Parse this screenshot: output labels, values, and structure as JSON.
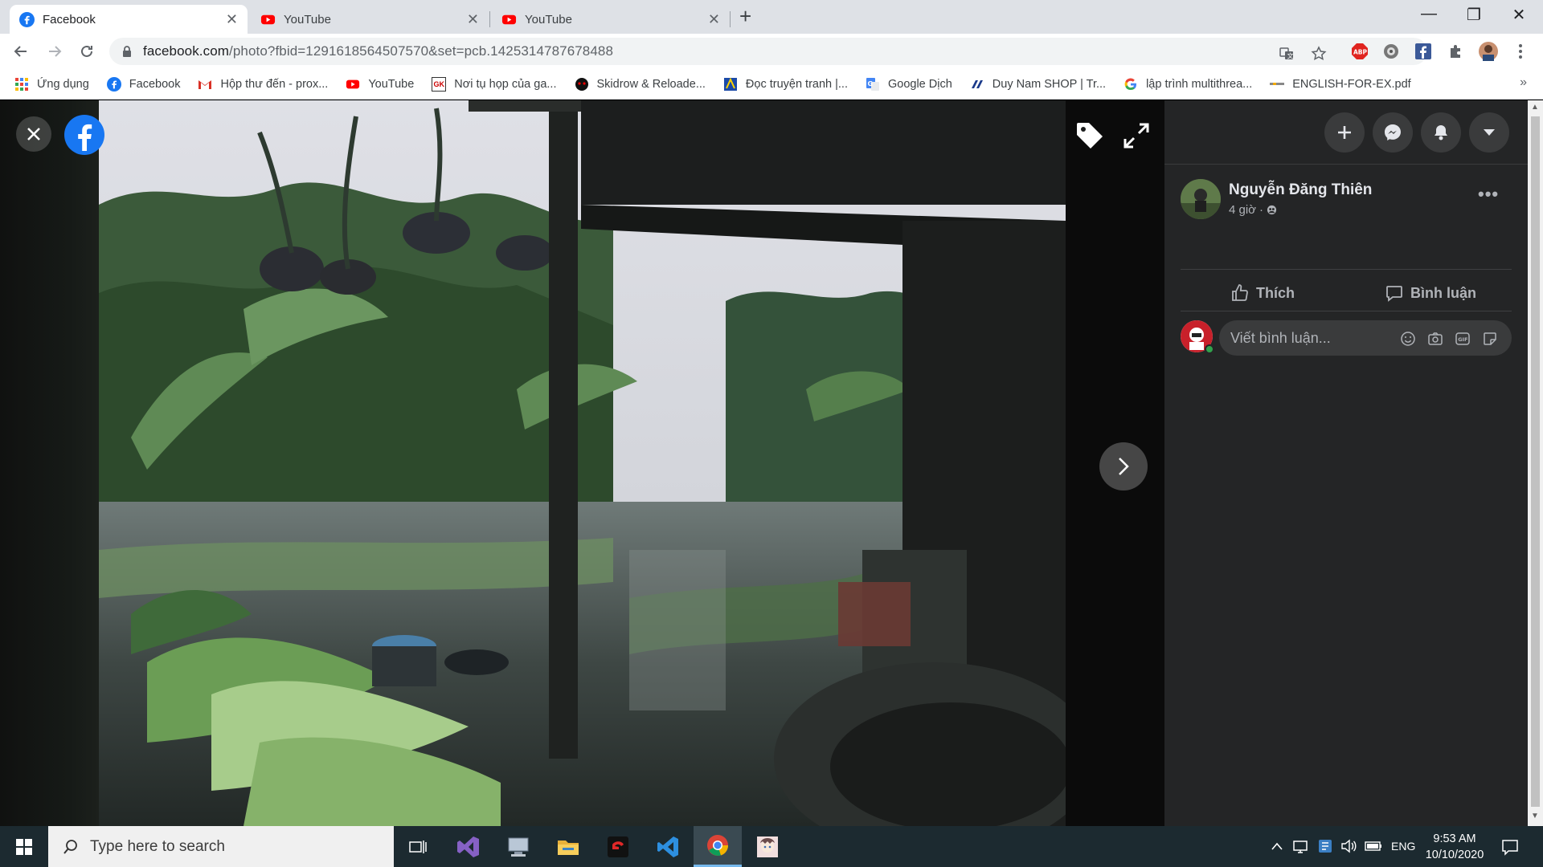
{
  "tabs": [
    {
      "title": "Facebook",
      "active": true,
      "favicon": "facebook-icon"
    },
    {
      "title": "YouTube",
      "active": false,
      "favicon": "youtube-icon"
    },
    {
      "title": "YouTube",
      "active": false,
      "favicon": "youtube-icon"
    }
  ],
  "window_controls": {
    "minimize": "—",
    "maximize": "❐",
    "close": "✕"
  },
  "address_bar": {
    "host": "facebook.com",
    "path": "/photo?fbid=1291618564507570&set=pcb.1425314787678488"
  },
  "bookmarks": [
    {
      "label": "Ứng dụng",
      "icon": "apps-grid-icon"
    },
    {
      "label": "Facebook",
      "icon": "facebook-icon"
    },
    {
      "label": "Hộp thư đến - prox...",
      "icon": "gmail-icon"
    },
    {
      "label": "YouTube",
      "icon": "youtube-icon"
    },
    {
      "label": "Nơi tụ họp của ga...",
      "icon": "gk-icon"
    },
    {
      "label": "Skidrow & Reloade...",
      "icon": "skidrow-icon"
    },
    {
      "label": "Đọc truyện tranh |...",
      "icon": "manga-icon"
    },
    {
      "label": "Google Dịch",
      "icon": "google-translate-icon"
    },
    {
      "label": "Duy Nam SHOP | Tr...",
      "icon": "shop-icon"
    },
    {
      "label": "lập trình multithrea...",
      "icon": "google-icon"
    },
    {
      "label": "ENGLISH-FOR-EX.pdf",
      "icon": "pdf-icon"
    }
  ],
  "bookmarks_overflow": "»",
  "post": {
    "author": "Nguyễn Đăng Thiên",
    "time": "4 giờ",
    "more": "•••",
    "like_label": "Thích",
    "comment_label": "Bình luận",
    "comment_placeholder": "Viết bình luận..."
  },
  "taskbar": {
    "search_placeholder": "Type here to search",
    "language": "ENG",
    "time": "9:53 AM",
    "date": "10/10/2020"
  },
  "colors": {
    "facebook_blue": "#1877f2",
    "panel_bg": "#242526",
    "youtube_red": "#ff0000",
    "online_green": "#31a24c"
  }
}
